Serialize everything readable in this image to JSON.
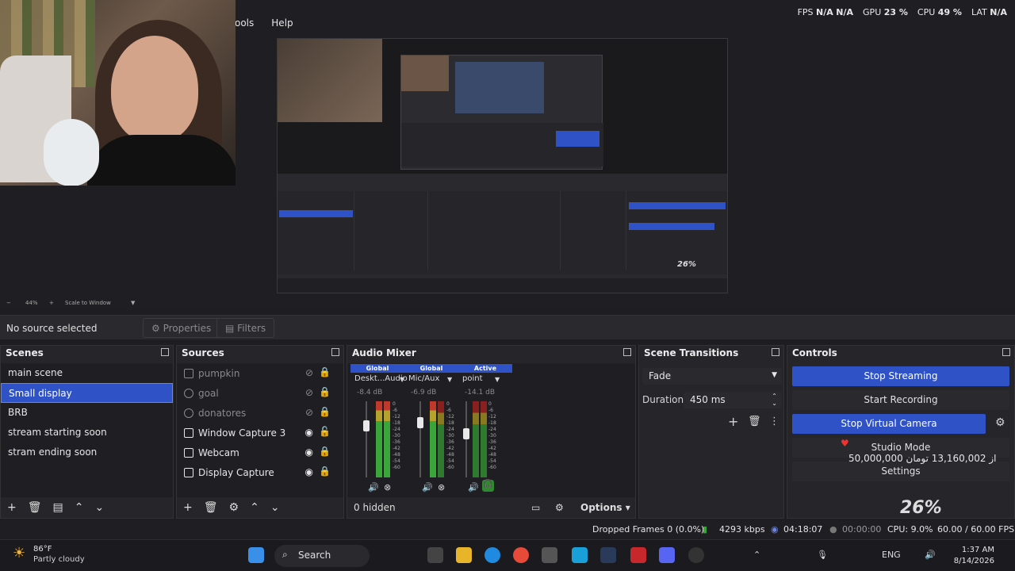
{
  "menu": {
    "items": [
      "ools",
      "Help"
    ]
  },
  "stats": {
    "fps_label": "FPS",
    "fps_val1": "N/A",
    "fps_val2": "N/A",
    "gpu_label": "GPU",
    "gpu_val": "23 %",
    "cpu_label": "CPU",
    "cpu_val": "49 %",
    "lat_label": "LAT",
    "lat_val": "N/A"
  },
  "zoom_bar": {
    "zoom": "44%",
    "scale_to_window": "Scale to Window"
  },
  "preview_overlay": {
    "percent": "26%"
  },
  "properties_bar": {
    "no_source": "No source selected",
    "properties_label": "Properties",
    "filters_label": "Filters"
  },
  "scenes": {
    "title": "Scenes",
    "items": [
      "main scene",
      "Small display",
      "BRB",
      "stream starting soon",
      "stram ending soon"
    ],
    "selected_index": 1
  },
  "sources": {
    "title": "Sources",
    "items": [
      {
        "name": "pumpkin",
        "visible": false
      },
      {
        "name": "goal",
        "visible": false
      },
      {
        "name": "donatores",
        "visible": false
      },
      {
        "name": "Window Capture 3",
        "visible": true
      },
      {
        "name": "Webcam",
        "visible": true
      },
      {
        "name": "Display Capture",
        "visible": true
      }
    ]
  },
  "audio_mixer": {
    "title": "Audio Mixer",
    "channels": [
      {
        "tag": "Global",
        "name": "Deskt...Audio",
        "db": "-8.4 dB"
      },
      {
        "tag": "Global",
        "name": "Mic/Aux",
        "db": "-6.9 dB"
      },
      {
        "tag": "Active",
        "name": "point",
        "db": "-14.1 dB"
      }
    ],
    "scale": [
      "0",
      "-6",
      "-12",
      "-18",
      "-24",
      "-30",
      "-36",
      "-42",
      "-48",
      "-54",
      "-60"
    ],
    "hidden": "0 hidden",
    "options": "Options"
  },
  "scene_transitions": {
    "title": "Scene Transitions",
    "transition": "Fade",
    "duration_label": "Duration",
    "duration_value": "450 ms"
  },
  "controls": {
    "title": "Controls",
    "stop_streaming": "Stop Streaming",
    "start_recording": "Start Recording",
    "stop_virtual_camera": "Stop Virtual Camera",
    "studio_mode": "Studio Mode",
    "donation_text": "50,000,000 از 13,160,002 تومان",
    "settings": "Settings",
    "overlay_percent": "26%"
  },
  "status_bar": {
    "dropped_frames": "Dropped Frames 0 (0.0%)",
    "bitrate": "4293 kbps",
    "stream_time": "04:18:07",
    "rec_time": "00:00:00",
    "cpu": "CPU: 9.0%",
    "fps": "60.00 / 60.00 FPS"
  },
  "taskbar": {
    "temp": "86°F",
    "condition": "Partly cloudy",
    "search": "Search",
    "lang": "ENG",
    "time": "1:37 AM",
    "date": "8/14/2026"
  },
  "colors": {
    "accent": "#2f52c7",
    "bg": "#1e1e22",
    "panel": "#26262a",
    "meter_green": "#3aa63a"
  }
}
